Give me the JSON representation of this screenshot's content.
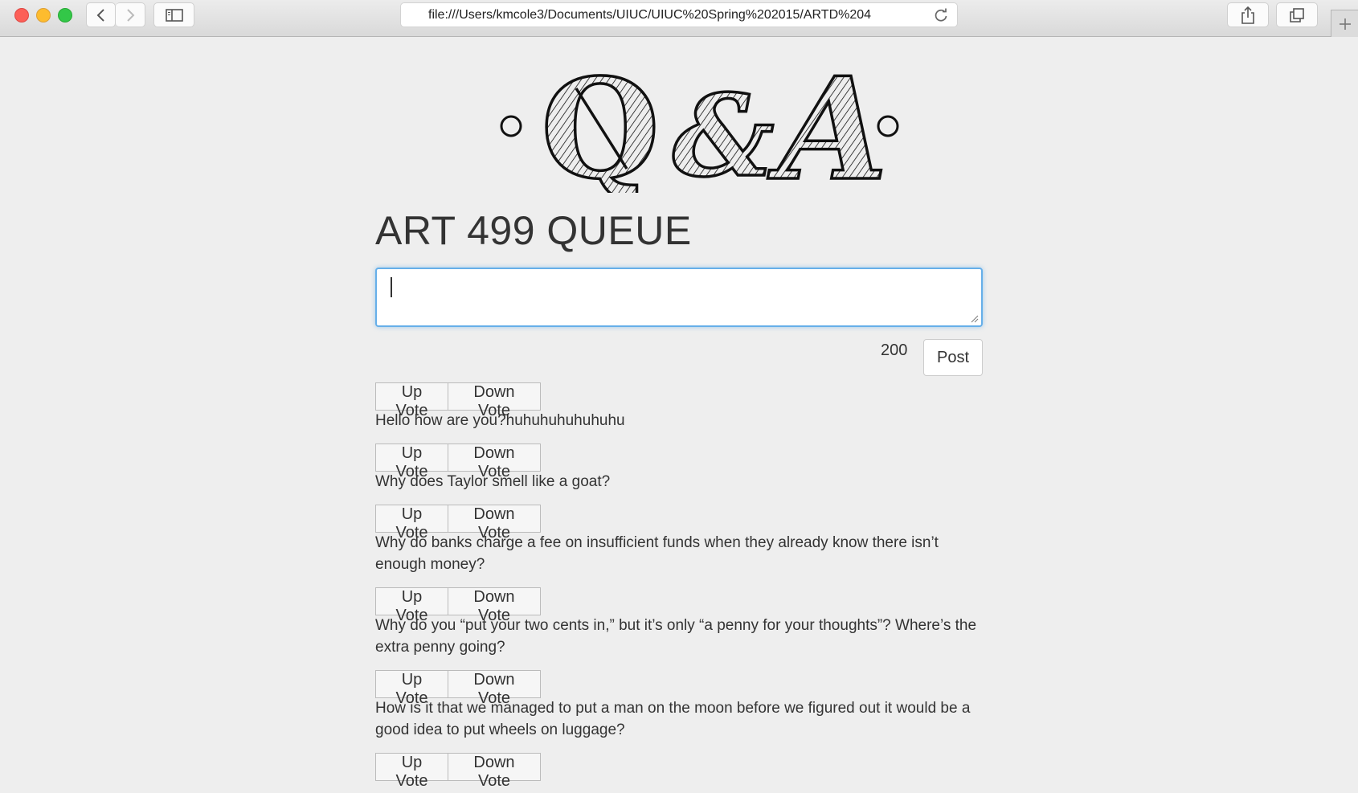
{
  "browser": {
    "url": "file:///Users/kmcole3/Documents/UIUC/UIUC%20Spring%202015/ARTD%204"
  },
  "page": {
    "logo_text": "Q&A",
    "title": "ART 499 QUEUE",
    "input_value": "",
    "char_count": "200",
    "post_label": "Post"
  },
  "vote": {
    "up_label": "Up Vote",
    "down_label": "Down Vote"
  },
  "questions": [
    {
      "text": "Hello how are you?huhuhuhuhuhuhu"
    },
    {
      "text": "Why does Taylor smell like a goat?"
    },
    {
      "text": "Why do banks charge a fee on insufficient funds when they already know there isn’t enough money?"
    },
    {
      "text": "Why do you “put your two cents in,” but it’s only “a penny for your thoughts”? Where’s the extra penny going?"
    },
    {
      "text": "How is it that we managed to put a man on the moon before we figured out it would be a good idea to put wheels on luggage?"
    },
    {
      "text": ""
    }
  ]
}
